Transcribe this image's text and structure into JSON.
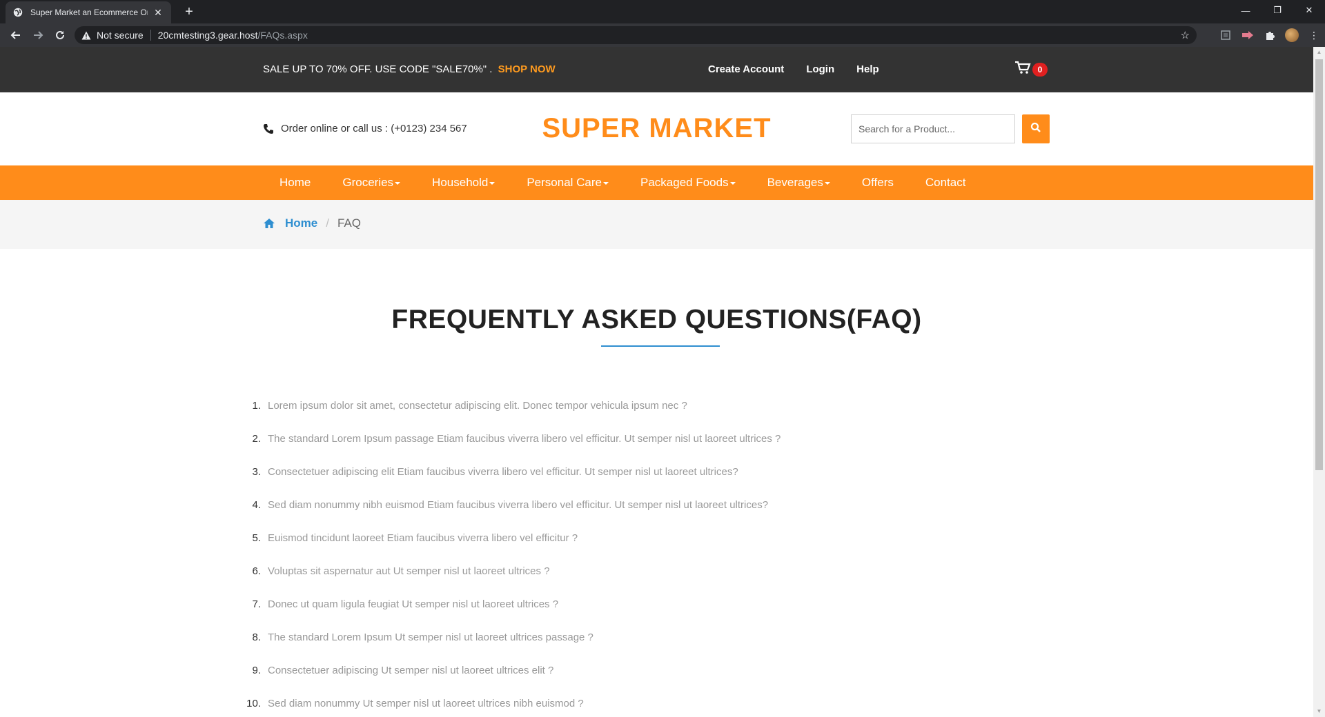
{
  "browser": {
    "tab_title": "Super Market an Ecommerce Onl",
    "not_secure": "Not secure",
    "url_host": "20cmtesting3.gear.host",
    "url_path": "/FAQs.aspx"
  },
  "topbar": {
    "promo": "SALE UP TO 70% OFF. USE CODE \"SALE70%\" .",
    "shop_now": "SHOP NOW",
    "links": [
      "Create Account",
      "Login",
      "Help"
    ],
    "cart_count": "0"
  },
  "header": {
    "call_text": "Order online or call us : (+0123) 234 567",
    "brand": "SUPER MARKET",
    "search_placeholder": "Search for a Product..."
  },
  "menu": {
    "items": [
      {
        "label": "Home",
        "dropdown": false
      },
      {
        "label": "Groceries",
        "dropdown": true
      },
      {
        "label": "Household",
        "dropdown": true
      },
      {
        "label": "Personal Care",
        "dropdown": true
      },
      {
        "label": "Packaged Foods",
        "dropdown": true
      },
      {
        "label": "Beverages",
        "dropdown": true
      },
      {
        "label": "Offers",
        "dropdown": false
      },
      {
        "label": "Contact",
        "dropdown": false
      }
    ]
  },
  "breadcrumb": {
    "home": "Home",
    "current": "FAQ"
  },
  "faq": {
    "title": "FREQUENTLY ASKED QUESTIONS(FAQ)",
    "questions": [
      {
        "num": "1.",
        "text": "Lorem ipsum dolor sit amet, consectetur adipiscing elit. Donec tempor vehicula ipsum nec ?"
      },
      {
        "num": "2.",
        "text": "The standard Lorem Ipsum passage Etiam faucibus viverra libero vel efficitur. Ut semper nisl ut laoreet ultrices ?"
      },
      {
        "num": "3.",
        "text": "Consectetuer adipiscing elit Etiam faucibus viverra libero vel efficitur. Ut semper nisl ut laoreet ultrices?"
      },
      {
        "num": "4.",
        "text": "Sed diam nonummy nibh euismod Etiam faucibus viverra libero vel efficitur. Ut semper nisl ut laoreet ultrices?"
      },
      {
        "num": "5.",
        "text": "Euismod tincidunt laoreet Etiam faucibus viverra libero vel efficitur ?"
      },
      {
        "num": "6.",
        "text": "Voluptas sit aspernatur aut Ut semper nisl ut laoreet ultrices ?"
      },
      {
        "num": "7.",
        "text": "Donec ut quam ligula feugiat Ut semper nisl ut laoreet ultrices ?"
      },
      {
        "num": "8.",
        "text": "The standard Lorem Ipsum Ut semper nisl ut laoreet ultrices passage ?"
      },
      {
        "num": "9.",
        "text": "Consectetuer adipiscing Ut semper nisl ut laoreet ultrices elit ?"
      },
      {
        "num": "10.",
        "text": "Sed diam nonummy Ut semper nisl ut laoreet ultrices nibh euismod ?"
      }
    ]
  },
  "colors": {
    "accent": "#ff8c1a",
    "link": "#2e8ed0",
    "topbar": "#333333",
    "badge": "#e02020"
  }
}
